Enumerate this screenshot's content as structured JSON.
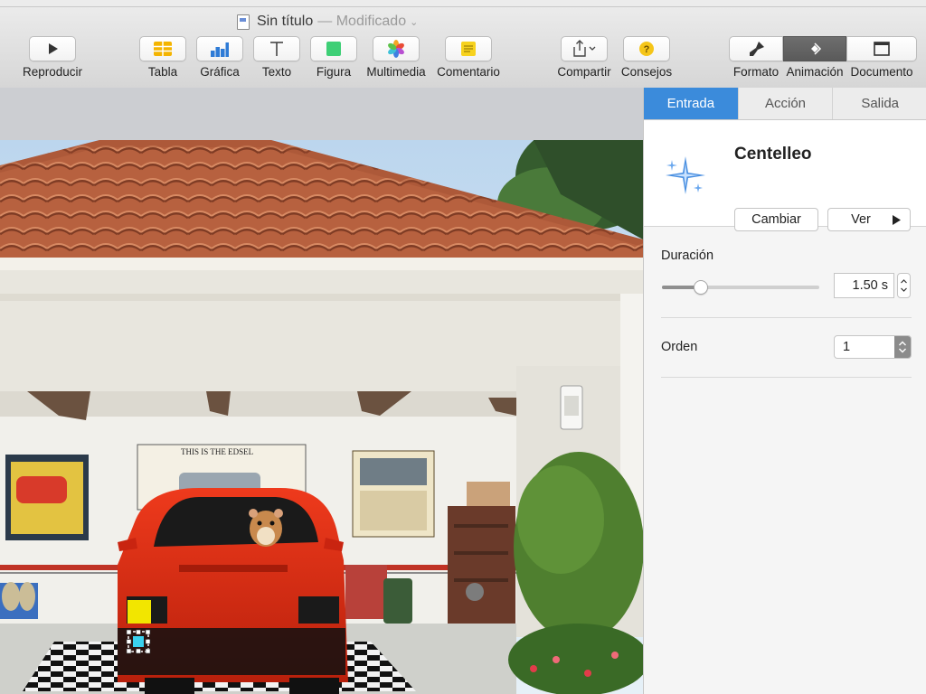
{
  "window": {
    "title": "Sin título",
    "status": "— Modificado"
  },
  "toolbar": {
    "items": [
      {
        "id": "play",
        "label": "Reproducir",
        "icon": "play-icon"
      },
      {
        "id": "table",
        "label": "Tabla",
        "icon": "table-icon"
      },
      {
        "id": "chart",
        "label": "Gráfica",
        "icon": "chart-icon"
      },
      {
        "id": "text",
        "label": "Texto",
        "icon": "text-icon"
      },
      {
        "id": "shape",
        "label": "Figura",
        "icon": "shape-icon"
      },
      {
        "id": "media",
        "label": "Multimedia",
        "icon": "media-icon"
      },
      {
        "id": "comment",
        "label": "Comentario",
        "icon": "comment-icon"
      },
      {
        "id": "share",
        "label": "Compartir",
        "icon": "share-icon"
      },
      {
        "id": "tips",
        "label": "Consejos",
        "icon": "tips-icon"
      },
      {
        "id": "format",
        "label": "Formato",
        "icon": "paintbrush-icon"
      },
      {
        "id": "animate",
        "label": "Animación",
        "icon": "animate-icon",
        "active": true
      },
      {
        "id": "document",
        "label": "Documento",
        "icon": "document-icon"
      }
    ]
  },
  "inspector": {
    "tabs": [
      {
        "label": "Entrada",
        "active": true
      },
      {
        "label": "Acción",
        "active": false
      },
      {
        "label": "Salida",
        "active": false
      }
    ],
    "effect": {
      "name": "Centelleo",
      "change_label": "Cambiar",
      "preview_label": "Ver",
      "icon": "sparkle-icon"
    },
    "duration": {
      "label": "Duración",
      "value": "1.50 s",
      "slider_fraction": 0.24
    },
    "order": {
      "label": "Orden",
      "value": "1"
    }
  },
  "slide": {
    "garage_sign": "THIS IS THE EDSEL"
  },
  "colors": {
    "accent": "#3b8bdb",
    "toolbar_bg": "#e2e2e2",
    "car": "#d92d14",
    "selected_shape": "#f2e600"
  }
}
